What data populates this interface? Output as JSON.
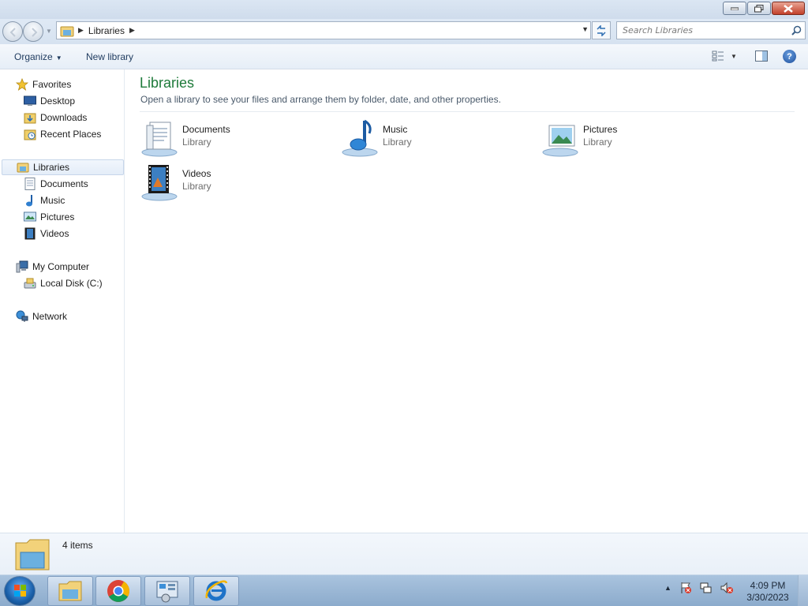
{
  "window": {
    "title": "Libraries",
    "controls": {
      "minimize": "minimize",
      "maximize": "restore",
      "close": "close"
    }
  },
  "address": {
    "crumb": "Libraries",
    "search_placeholder": "Search Libraries"
  },
  "toolbar": {
    "organize_label": "Organize",
    "new_library_label": "New library"
  },
  "nav": {
    "favorites": {
      "label": "Favorites",
      "items": [
        "Desktop",
        "Downloads",
        "Recent Places"
      ]
    },
    "libraries": {
      "label": "Libraries",
      "items": [
        "Documents",
        "Music",
        "Pictures",
        "Videos"
      ]
    },
    "computer": {
      "label": "My Computer",
      "items": [
        "Local Disk (C:)"
      ]
    },
    "network": {
      "label": "Network"
    }
  },
  "content": {
    "heading": "Libraries",
    "subheading": "Open a library to see your files and arrange them by folder, date, and other properties.",
    "libraries": [
      {
        "name": "Documents",
        "type": "Library",
        "icon": "documents-library-icon"
      },
      {
        "name": "Music",
        "type": "Library",
        "icon": "music-library-icon"
      },
      {
        "name": "Pictures",
        "type": "Library",
        "icon": "pictures-library-icon"
      },
      {
        "name": "Videos",
        "type": "Library",
        "icon": "videos-library-icon"
      }
    ]
  },
  "status": {
    "item_count": "4 items"
  },
  "taskbar": {
    "apps": [
      "windows-explorer-icon",
      "chrome-icon",
      "control-panel-icon",
      "internet-explorer-icon"
    ],
    "clock": {
      "time": "4:09 PM",
      "date": "3/30/2023"
    }
  },
  "colors": {
    "heading_green": "#1e7a3a",
    "link_blue": "#1e3a5e",
    "taskbar": "#9db8d6"
  }
}
